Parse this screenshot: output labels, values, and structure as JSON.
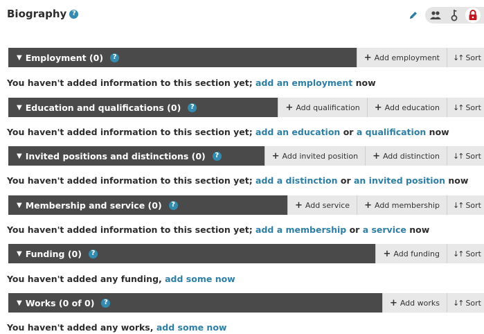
{
  "header": {
    "title": "Biography",
    "help_icon": "?",
    "icons": [
      "pencil-icon",
      "group-icon",
      "key-icon",
      "lock-icon"
    ],
    "colors": {
      "accent": "#338caf",
      "link": "#2e7fa6",
      "bar": "#4a4a4a",
      "lock": "#c0171f"
    }
  },
  "sort_label": "Sort",
  "sections": {
    "employment": {
      "title": "Employment (0)",
      "actions": [
        "Add employment"
      ],
      "msg_prefix": "You haven't added information to this section yet; ",
      "link1": "add an employment",
      "msg_suffix": " now"
    },
    "education": {
      "title": "Education and qualifications (0)",
      "actions": [
        "Add qualification",
        "Add education"
      ],
      "msg_prefix": "You haven't added information to this section yet; ",
      "link1": "add an education",
      "mid": " or ",
      "link2": "a qualification",
      "msg_suffix": " now"
    },
    "invited": {
      "title": "Invited positions and distinctions (0)",
      "actions": [
        "Add invited position",
        "Add distinction"
      ],
      "msg_prefix": "You haven't added information to this section yet; ",
      "link1": "add a distinction",
      "mid": " or ",
      "link2": "an invited position",
      "msg_suffix": " now"
    },
    "membership": {
      "title": "Membership and service (0)",
      "actions": [
        "Add service",
        "Add membership"
      ],
      "msg_prefix": "You haven't added information to this section yet; ",
      "link1": "add a membership",
      "mid": " or ",
      "link2": "a service",
      "msg_suffix": " now"
    },
    "funding": {
      "title": "Funding (0)",
      "actions": [
        "Add funding"
      ],
      "msg_prefix": "You haven't added any funding, ",
      "link1": "add some now"
    },
    "works": {
      "title": "Works (0 of 0)",
      "actions": [
        "Add works"
      ],
      "msg_prefix": "You haven't added any works, ",
      "link1": "add some now"
    }
  }
}
